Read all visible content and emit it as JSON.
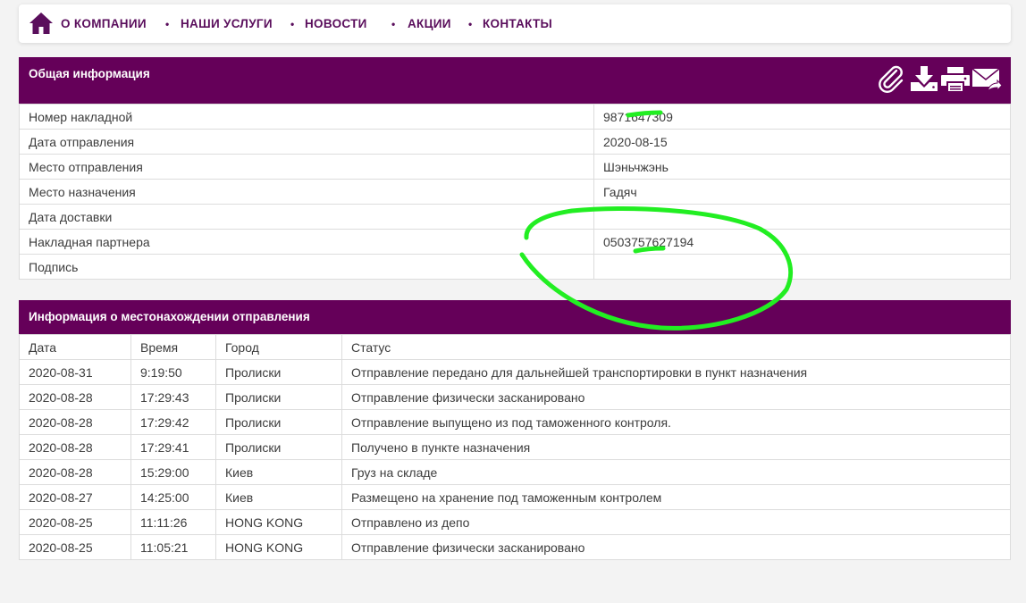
{
  "nav": {
    "items": [
      "О КОМПАНИИ",
      "НАШИ УСЛУГИ",
      "НОВОСТИ",
      "АКЦИИ",
      "КОНТАКТЫ"
    ],
    "separator": "•"
  },
  "general": {
    "title": "Общая информация",
    "rows": [
      {
        "label": "Номер накладной",
        "value": "9871647309"
      },
      {
        "label": "Дата отправления",
        "value": "2020-08-15"
      },
      {
        "label": "Место отправления",
        "value": "Шэньчжэнь"
      },
      {
        "label": "Место назначения",
        "value": "Гадяч"
      },
      {
        "label": "Дата доставки",
        "value": ""
      },
      {
        "label": "Накладная партнера",
        "value": "0503757627194"
      },
      {
        "label": "Подпись",
        "value": ""
      }
    ],
    "tools": [
      "paperclip-icon",
      "download-icon",
      "print-icon",
      "email-forward-icon"
    ]
  },
  "tracking": {
    "title": "Информация о местонахождении отправления",
    "columns": [
      "Дата",
      "Время",
      "Город",
      "Статус"
    ],
    "rows": [
      [
        "2020-08-31",
        "9:19:50",
        "Пролиски",
        "Отправление передано для дальнейшей транспортировки в пункт назначения"
      ],
      [
        "2020-08-28",
        "17:29:43",
        "Пролиски",
        "Отправление физически засканировано"
      ],
      [
        "2020-08-28",
        "17:29:42",
        "Пролиски",
        "Отправление выпущено из под таможенного контроля."
      ],
      [
        "2020-08-28",
        "17:29:41",
        "Пролиски",
        "Получено в пункте назначения"
      ],
      [
        "2020-08-28",
        "15:29:00",
        "Киев",
        "Груз на складе"
      ],
      [
        "2020-08-27",
        "14:25:00",
        "Киев",
        "Размещено на хранение под таможенным контролем"
      ],
      [
        "2020-08-25",
        "11:11:26",
        "HONG KONG",
        "Отправлено из депо"
      ],
      [
        "2020-08-25",
        "11:05:21",
        "HONG KONG",
        "Отправление физически засканировано"
      ]
    ]
  },
  "colors": {
    "brand_purple": "#650059",
    "nav_text": "#5a0e5c",
    "annotation_green": "#22ee22"
  }
}
